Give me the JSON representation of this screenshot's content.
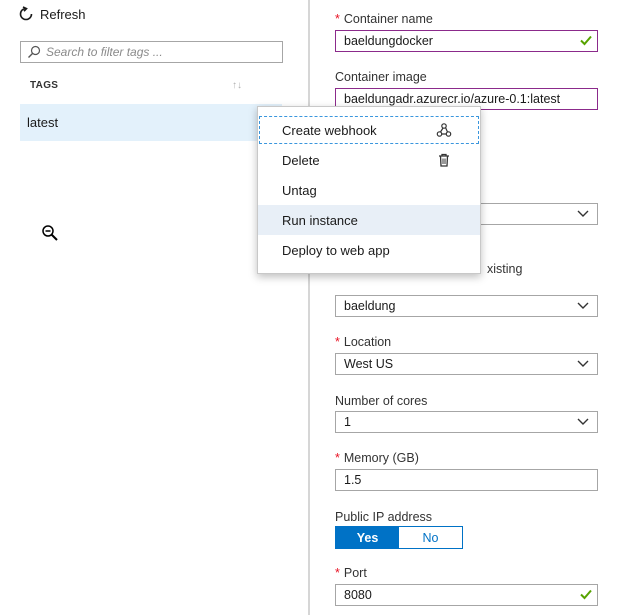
{
  "toolbar": {
    "refresh_label": "Refresh"
  },
  "tags_panel": {
    "search_placeholder": "Search to filter tags ...",
    "column_header": "TAGS",
    "sort_icon": "sort-arrows-icon",
    "rows": [
      {
        "label": "latest"
      }
    ]
  },
  "context_menu": {
    "items": [
      {
        "label": "Create webhook",
        "icon": "webhook-icon"
      },
      {
        "label": "Delete",
        "icon": "trash-icon"
      },
      {
        "label": "Untag"
      },
      {
        "label": "Run instance"
      },
      {
        "label": "Deploy to web app"
      }
    ]
  },
  "form": {
    "container_name": {
      "label": "Container name",
      "value": "baeldungdocker",
      "required": true
    },
    "container_image": {
      "label": "Container image",
      "value": "baeldungadr.azurecr.io/azure-0.1:latest"
    },
    "resource_group": {
      "radio_partial_label": "xisting",
      "value": "baeldung"
    },
    "location": {
      "label": "Location",
      "value": "West US",
      "required": true
    },
    "cores": {
      "label": "Number of cores",
      "value": "1"
    },
    "memory": {
      "label": "Memory (GB)",
      "value": "1.5",
      "required": true
    },
    "public_ip": {
      "label": "Public IP address",
      "yes": "Yes",
      "no": "No"
    },
    "port": {
      "label": "Port",
      "value": "8080",
      "required": true
    }
  },
  "colors": {
    "accent": "#0072c6",
    "selected_row": "#e3f1fb",
    "required": "#e81123",
    "valid_check": "#57a300",
    "focus_border": "#8b2a8b"
  }
}
